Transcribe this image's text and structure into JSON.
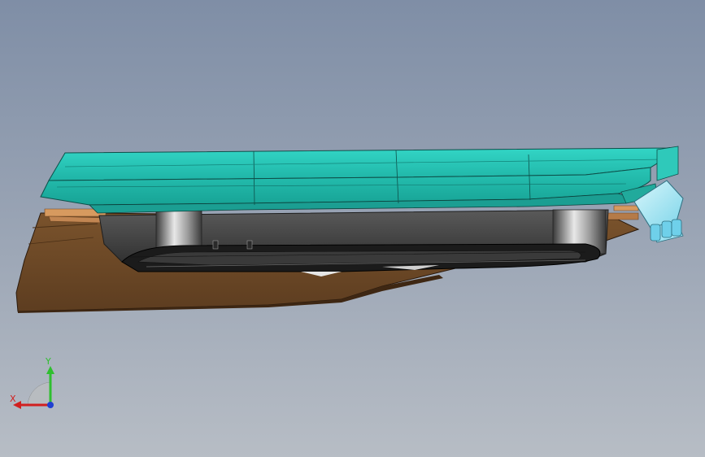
{
  "viewport": {
    "background_top": "#7f8ea6",
    "background_bottom": "#b7bdc5"
  },
  "model": {
    "parts": [
      {
        "name": "base-plate",
        "color": "#6b4726"
      },
      {
        "name": "housing",
        "color": "#4b4b4b"
      },
      {
        "name": "cover",
        "color": "#2ec7b7"
      },
      {
        "name": "connector",
        "color": "#a9e7f3"
      }
    ]
  },
  "triad": {
    "x_label": "X",
    "y_label": "Y",
    "x_color": "#d11f1f",
    "y_color": "#2fbf2f",
    "z_color": "#1f3fd1"
  }
}
